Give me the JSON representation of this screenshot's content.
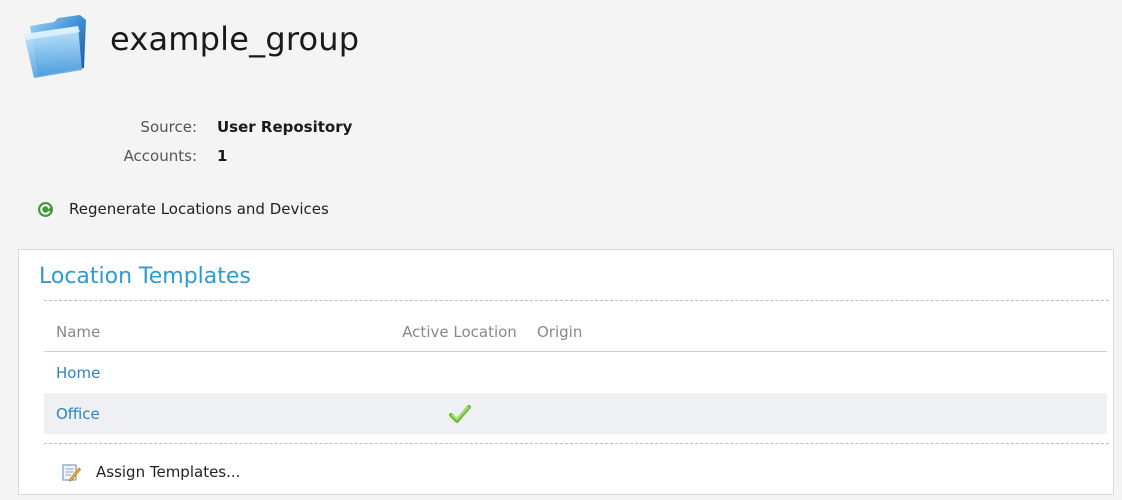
{
  "header": {
    "title": "example_group",
    "icon": "folder-icon"
  },
  "details": {
    "source_label": "Source:",
    "source_value": "User Repository",
    "accounts_label": "Accounts:",
    "accounts_value": "1"
  },
  "actions": {
    "regenerate_label": "Regenerate Locations and Devices",
    "regenerate_icon": "refresh-icon"
  },
  "location_templates": {
    "title": "Location Templates",
    "columns": [
      "Name",
      "Active Location",
      "Origin"
    ],
    "rows": [
      {
        "name": "Home",
        "active": false,
        "origin": ""
      },
      {
        "name": "Office",
        "active": true,
        "origin": ""
      }
    ],
    "assign_label": "Assign Templates...",
    "assign_icon": "edit-note-icon"
  },
  "colors": {
    "accent": "#2d9bd2",
    "link": "#2a83c2",
    "check": "#6cbf2c"
  }
}
